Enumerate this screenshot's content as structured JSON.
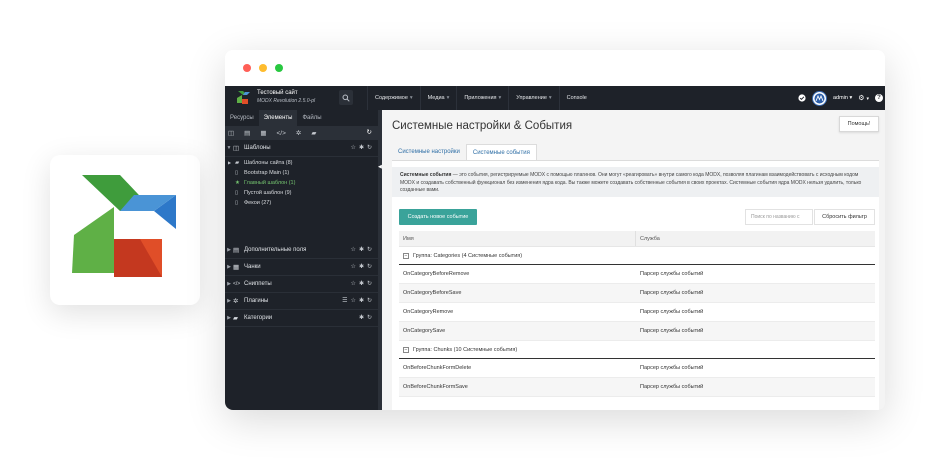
{
  "window": {
    "controls": [
      "close",
      "minimize",
      "maximize"
    ]
  },
  "header": {
    "site_name": "Тестовый сайт",
    "version": "MODX Revolution 2.5.0-pl",
    "menu": [
      {
        "label": "Содержимое",
        "caret": "▾"
      },
      {
        "label": "Медиа",
        "caret": "▾"
      },
      {
        "label": "Приложения",
        "caret": "▾"
      },
      {
        "label": "Управление",
        "caret": "▾"
      },
      {
        "label": "Console",
        "caret": ""
      }
    ],
    "user": "admin",
    "user_caret": "▾",
    "settings_caret": "▾",
    "help_glyph": "?"
  },
  "sidebar": {
    "tabs": [
      "Ресурсы",
      "Элементы",
      "Файлы"
    ],
    "sections": [
      {
        "label": "Шаблоны",
        "arrow": "▼",
        "icon": "template-icon",
        "glyph": "◫",
        "acts": [
          "☆",
          "✱",
          "↻"
        ]
      },
      {
        "label": "Дополнительные поля",
        "arrow": "▶",
        "icon": "tv-icon",
        "glyph": "▤",
        "acts": [
          "☆",
          "✱",
          "↻"
        ]
      },
      {
        "label": "Чанки",
        "arrow": "▶",
        "icon": "chunk-icon",
        "glyph": "▦",
        "acts": [
          "☆",
          "✱",
          "↻"
        ]
      },
      {
        "label": "Сниппеты",
        "arrow": "▶",
        "icon": "snippet-icon",
        "glyph": "</>",
        "acts": [
          "☆",
          "✱",
          "↻"
        ]
      },
      {
        "label": "Плагины",
        "arrow": "▶",
        "icon": "plugin-icon",
        "glyph": "✲",
        "acts": [
          "☰",
          "☆",
          "✱",
          "↻"
        ]
      },
      {
        "label": "Категории",
        "arrow": "▶",
        "icon": "folder-icon",
        "glyph": "▰",
        "acts": [
          "✱",
          "↻"
        ]
      }
    ],
    "template_tree": [
      {
        "label": "Шаблоны сайта (8)",
        "arrow": "▶",
        "glyph": "▰",
        "level": 0
      },
      {
        "label": "Bootstrap Main (1)",
        "arrow": "",
        "glyph": "▯",
        "level": 1
      },
      {
        "label": "Главный шаблон (1)",
        "arrow": "",
        "glyph": "★",
        "level": 1,
        "active": true
      },
      {
        "label": "Пустой шаблон (9)",
        "arrow": "",
        "glyph": "▯",
        "level": 1
      },
      {
        "label": "Фекои (27)",
        "arrow": "",
        "glyph": "▯",
        "level": 1
      }
    ]
  },
  "main": {
    "title": "Системные настройки & События",
    "help_label": "Помощь!",
    "tabs": [
      "Системные настройки",
      "Системные события"
    ],
    "description_bold": "Системные события",
    "description_text": " — это события, регистрируемые MODX с помощью плагинов. Они могут «реагировать» внутри самого кода MODX, позволяя плагинам взаимодействовать с исходным кодом MODX и создавать собственный функционал без изменения ядра кода. Вы также можете создавать собственные события в своих проектах. Системные события ядра MODX нельзя удалить, только созданные вами.",
    "create_button": "Создать новое событие",
    "search_placeholder": "Поиск по названию с",
    "reset_button": "Сбросить фильтр",
    "columns": [
      "Имя",
      "Служба"
    ],
    "groups": [
      {
        "label": "Группа: Categories (4 Системные события)",
        "rows": [
          {
            "name": "OnCategoryBeforeRemove",
            "service": "Парсер службы событий"
          },
          {
            "name": "OnCategoryBeforeSave",
            "service": "Парсер службы событий"
          },
          {
            "name": "OnCategoryRemove",
            "service": "Парсер службы событий"
          },
          {
            "name": "OnCategorySave",
            "service": "Парсер службы событий"
          }
        ]
      },
      {
        "label": "Группа: Chunks (10 Системные события)",
        "rows": [
          {
            "name": "OnBeforeChunkFormDelete",
            "service": "Парсер службы событий"
          },
          {
            "name": "OnBeforeChunkFormSave",
            "service": "Парсер службы событий"
          }
        ]
      }
    ]
  },
  "colors": {
    "dark": "#1e2229",
    "accent_green": "#3aa39a",
    "link": "#2f6fa6",
    "active_tree": "#74c36f"
  }
}
